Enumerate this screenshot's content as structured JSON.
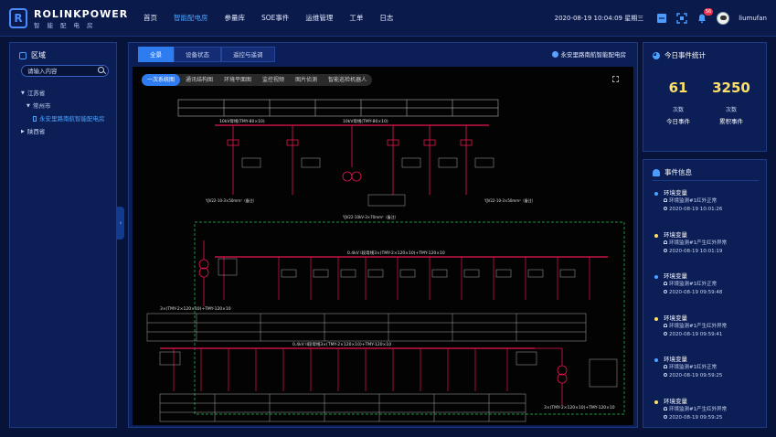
{
  "brand": {
    "name": "ROLINKPOWER",
    "subtitle": "智能配电房",
    "mark": "R"
  },
  "nav": [
    {
      "label": "首页",
      "active": false
    },
    {
      "label": "智能配电房",
      "active": true
    },
    {
      "label": "参量库",
      "active": false
    },
    {
      "label": "SOE事件",
      "active": false
    },
    {
      "label": "运维管理",
      "active": false
    },
    {
      "label": "工单",
      "active": false
    },
    {
      "label": "日志",
      "active": false
    }
  ],
  "header": {
    "datetime": "2020-08-19 10:04:09 星期三",
    "notification_count": "56",
    "username": "liumufan"
  },
  "sidebar": {
    "title": "区域",
    "search_placeholder": "请输入内容",
    "tree": [
      {
        "label": "江苏省",
        "level": 1,
        "expanded": true
      },
      {
        "label": "常州市",
        "level": 2,
        "expanded": true
      },
      {
        "label": "永安里路南航智能配电房",
        "level": 3,
        "selected": true
      },
      {
        "label": "陕西省",
        "level": 1,
        "expanded": false
      }
    ]
  },
  "main": {
    "tabs": [
      {
        "label": "全景",
        "active": true
      },
      {
        "label": "设备状态",
        "active": false
      },
      {
        "label": "遥控与遥调",
        "active": false
      }
    ],
    "station_name": "永安里路南航智能配电房",
    "subtabs": [
      {
        "label": "一次系统图",
        "active": true
      },
      {
        "label": "通讯结构图",
        "active": false
      },
      {
        "label": "环境平面图",
        "active": false
      },
      {
        "label": "监控视频",
        "active": false
      },
      {
        "label": "图片侦测",
        "active": false
      },
      {
        "label": "智能巡检机器人",
        "active": false
      }
    ],
    "diagram_labels": {
      "bus1": "0.4kV I段母线3×(TMY-2×120×10)+TMY-120×10",
      "bus2": "0.4kV II段母线3×(TMY-2×120×10)+TMY-120×10",
      "cable1": "3×(TMY-2×120×10)+TMY-120×10",
      "cable2": "3×(TMY-2×120×10)+TMY-120×10",
      "hv1": "YJV22-10-3×50mm²（备注）",
      "hv2": "YJV22-10kV-3×70mm²（备注）",
      "hv3": "YJV22-10-3×50mm²（备注）",
      "top_bus": "10kV母线(TMY-80×10)",
      "top_bus2": "10kV母线(TMY-80×10)"
    }
  },
  "stats": {
    "title": "今日事件统计",
    "items": [
      {
        "value": "61",
        "unit": "次数",
        "label": "今日事件"
      },
      {
        "value": "3250",
        "unit": "次数",
        "label": "累积事件"
      }
    ]
  },
  "events": {
    "title": "事件信息",
    "items": [
      {
        "title": "环境变量",
        "desc": "环境监测#1红外正常",
        "time": "2020-08-19 10:01:26",
        "dot_color": "#4aa3ff"
      },
      {
        "title": "环境变量",
        "desc": "环境监测#1产生红外异常",
        "time": "2020-08-19 10:01:19",
        "dot_color": "#ffe066"
      },
      {
        "title": "环境变量",
        "desc": "环境监测#1红外正常",
        "time": "2020-08-19 09:59:48",
        "dot_color": "#4aa3ff"
      },
      {
        "title": "环境变量",
        "desc": "环境监测#1产生红外异常",
        "time": "2020-08-19 09:59:41",
        "dot_color": "#ffe066"
      },
      {
        "title": "环境变量",
        "desc": "环境监测#1红外正常",
        "time": "2020-08-19 09:59:25",
        "dot_color": "#4aa3ff"
      },
      {
        "title": "环境变量",
        "desc": "环境监测#1产生红外异常",
        "time": "2020-08-19 09:59:25",
        "dot_color": "#ffe066"
      }
    ]
  },
  "colors": {
    "accent": "#2f7bf0",
    "highlight": "#ffe066",
    "diagram_line": "#e8154e",
    "diagram_bg": "#030303"
  }
}
